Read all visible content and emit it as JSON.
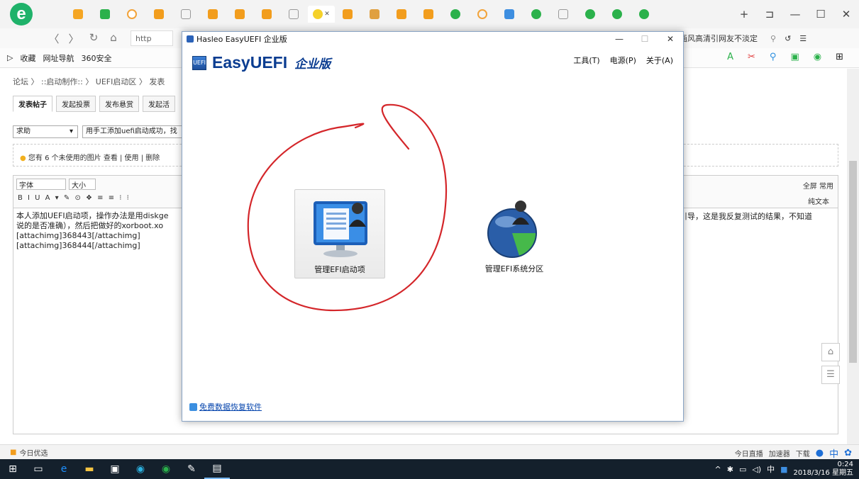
{
  "browser": {
    "logo_letter": "e",
    "url_partial": "http",
    "addr_right_text": "画风高清引网友不淡定",
    "window_controls": [
      "+",
      "⊐",
      "—",
      "☐",
      "✕"
    ]
  },
  "bookmarks": [
    "收藏",
    "网址导航",
    "360安全"
  ],
  "page": {
    "breadcrumb": "论坛 〉 ::启动制作:: 〉 UEFI启动区 〉 发表",
    "tabs": [
      "发表帖子",
      "发起投票",
      "发布悬赏",
      "发起活"
    ],
    "category": "求助",
    "subject": "用手工添加uefi启动成功，找",
    "image_note": "您有 6 个未使用的图片  查看 | 使用 | 删除",
    "font_select": "字体",
    "size_select": "大小",
    "format_tools": "B I U A ▾ ✎ ⊙ ❖ ≡ ≡ ⁝ ⁝",
    "fullscreen": "全屏 常用",
    "plaintext": "纯文本",
    "body_lines": [
      "本人添加UEFI启动项，操作办法是用diskge",
      "说的是否准确），然后把做好的xorboot.xo",
      "[attachimg]368443[/attachimg]",
      "[attachimg]368444[/attachimg]"
    ],
    "body_right": "引导，这是我反复测试的结果，不知道"
  },
  "status": {
    "left": "今日优选",
    "right": [
      "今日直播",
      "加速器",
      "下载"
    ]
  },
  "taskbar": {
    "time": "0:24",
    "date": "2018/3/16 星期五",
    "ime": "中"
  },
  "dialog": {
    "title": "Hasleo EasyUEFI 企业版",
    "brand": "EasyUEFI",
    "edition": "企业版",
    "menu": [
      "工具(T)",
      "电源(P)",
      "关于(A)"
    ],
    "tile1_label": "管理EFI启动项",
    "tile2_label": "管理EFI系统分区",
    "footer_link": "免费数据恢复软件",
    "controls": [
      "—",
      "☐",
      "✕"
    ]
  }
}
